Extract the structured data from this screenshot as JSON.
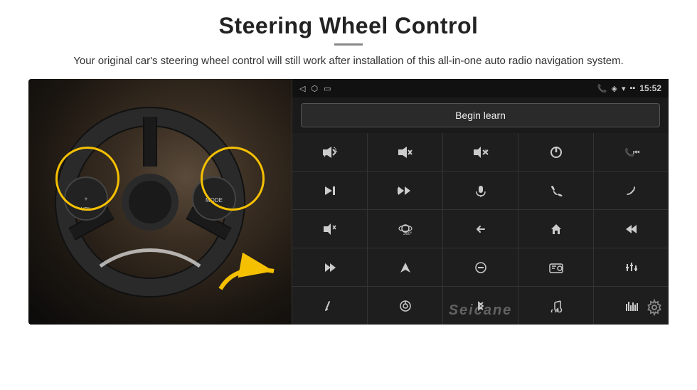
{
  "header": {
    "title": "Steering Wheel Control",
    "subtitle": "Your original car's steering wheel control will still work after installation of this all-in-one auto radio navigation system.",
    "divider": true
  },
  "status_bar": {
    "left_icons": [
      "◁",
      "⬡",
      "▭"
    ],
    "battery_signal": "▪▪",
    "phone_icon": "📞",
    "location_icon": "◈",
    "wifi_icon": "▾",
    "time": "15:52"
  },
  "begin_learn": {
    "label": "Begin learn"
  },
  "controls": [
    {
      "icon": "🔊+",
      "name": "vol-up"
    },
    {
      "icon": "🔊−",
      "name": "vol-down"
    },
    {
      "icon": "🔇",
      "name": "mute"
    },
    {
      "icon": "⏻",
      "name": "power"
    },
    {
      "icon": "⏮",
      "name": "prev-track-phone"
    },
    {
      "icon": "⏭",
      "name": "next"
    },
    {
      "icon": "⏩",
      "name": "fast-forward"
    },
    {
      "icon": "🎤",
      "name": "mic"
    },
    {
      "icon": "📞",
      "name": "call"
    },
    {
      "icon": "📵",
      "name": "end-call"
    },
    {
      "icon": "📢",
      "name": "horn"
    },
    {
      "icon": "360",
      "name": "360-view"
    },
    {
      "icon": "↩",
      "name": "back"
    },
    {
      "icon": "⌂",
      "name": "home"
    },
    {
      "icon": "⏮⏮",
      "name": "prev-track"
    },
    {
      "icon": "⏭⏭",
      "name": "skip"
    },
    {
      "icon": "➤",
      "name": "nav"
    },
    {
      "icon": "⊖",
      "name": "eject"
    },
    {
      "icon": "📻",
      "name": "radio"
    },
    {
      "icon": "⚙",
      "name": "eq"
    },
    {
      "icon": "✏",
      "name": "edit"
    },
    {
      "icon": "⊙",
      "name": "menu"
    },
    {
      "icon": "✱",
      "name": "bluetooth"
    },
    {
      "icon": "♪",
      "name": "music"
    },
    {
      "icon": "|||",
      "name": "spectrum"
    }
  ],
  "watermark": "Seicane",
  "gear": "⚙"
}
